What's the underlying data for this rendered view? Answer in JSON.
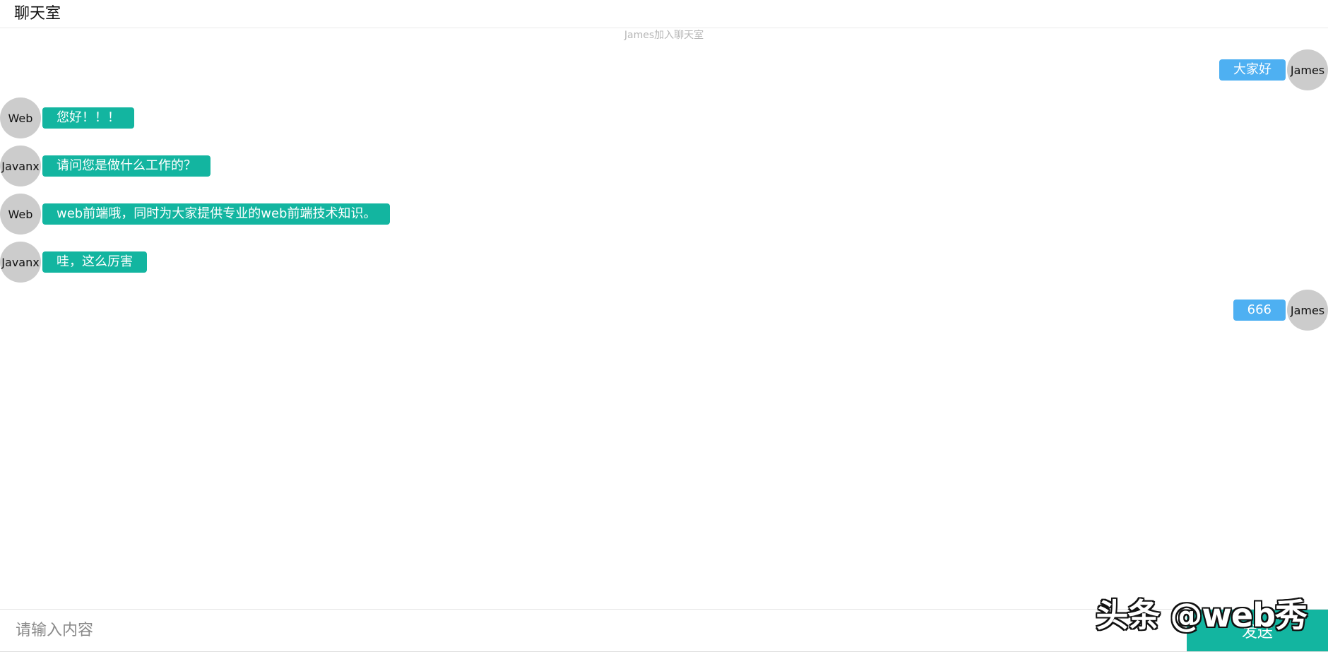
{
  "header": {
    "title": "聊天室"
  },
  "system_notice": "James加入聊天室",
  "colors": {
    "self_bubble": "#4eb0f2",
    "other_bubble": "#13b5a0",
    "send_button": "#13b5a0",
    "avatar": "#cccccc"
  },
  "messages": [
    {
      "sender": "James",
      "text": "大家好",
      "side": "right"
    },
    {
      "sender": "Web",
      "text": "您好！！！",
      "side": "left"
    },
    {
      "sender": "Javanx",
      "text": "请问您是做什么工作的？",
      "side": "left"
    },
    {
      "sender": "Web",
      "text": "web前端哦，同时为大家提供专业的web前端技术知识。",
      "side": "left"
    },
    {
      "sender": "Javanx",
      "text": "哇，这么厉害",
      "side": "left"
    },
    {
      "sender": "James",
      "text": "666",
      "side": "right"
    }
  ],
  "composer": {
    "placeholder": "请输入内容",
    "value": "",
    "send_label": "发送"
  },
  "watermark": "头条 @web秀"
}
